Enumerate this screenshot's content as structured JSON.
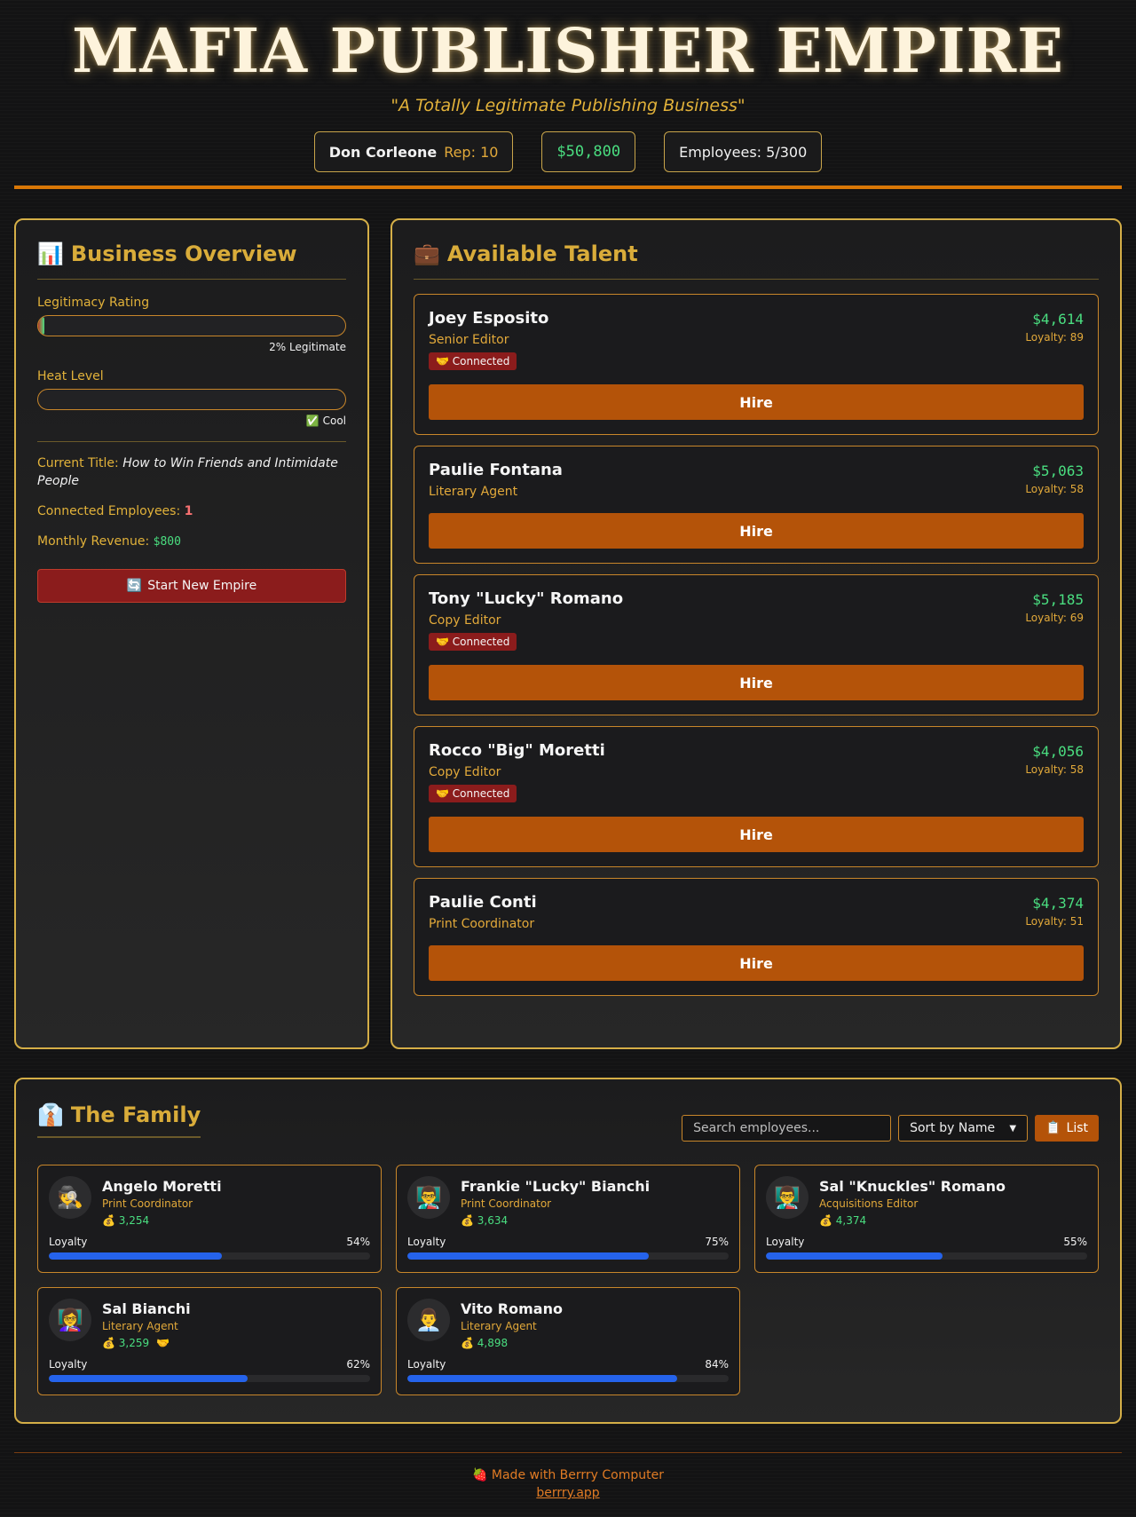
{
  "header": {
    "title": "MAFIA PUBLISHER EMPIRE",
    "subtitle": "\"A Totally Legitimate Publishing Business\"",
    "boss_name": "Don Corleone",
    "rep": "Rep: 10",
    "cash": "$50,800",
    "employees": "Employees: 5/300"
  },
  "overview": {
    "heading_icon": "📊",
    "heading": "Business Overview",
    "legitimacy_label": "Legitimacy Rating",
    "legitimacy_value": 2,
    "legitimacy_caption": "2% Legitimate",
    "heat_label": "Heat Level",
    "heat_value": 0,
    "heat_caption": "✅ Cool",
    "current_title_label": "Current Title:",
    "current_title": "How to Win Friends and Intimidate People",
    "connected_label": "Connected Employees:",
    "connected_value": "1",
    "revenue_label": "Monthly Revenue:",
    "revenue_value": "$800",
    "new_empire_icon": "🔄",
    "new_empire_label": "Start New Empire"
  },
  "talent": {
    "heading_icon": "💼",
    "heading": "Available Talent",
    "hire_label": "Hire",
    "candidates": [
      {
        "name": "Joey Esposito",
        "role": "Senior Editor",
        "price": "$4,614",
        "loyalty": "Loyalty: 89",
        "badge": "🤝 Connected"
      },
      {
        "name": "Paulie Fontana",
        "role": "Literary Agent",
        "price": "$5,063",
        "loyalty": "Loyalty: 58",
        "badge": ""
      },
      {
        "name": "Tony \"Lucky\" Romano",
        "role": "Copy Editor",
        "price": "$5,185",
        "loyalty": "Loyalty: 69",
        "badge": "🤝 Connected"
      },
      {
        "name": "Rocco \"Big\" Moretti",
        "role": "Copy Editor",
        "price": "$4,056",
        "loyalty": "Loyalty: 58",
        "badge": "🤝 Connected"
      },
      {
        "name": "Paulie Conti",
        "role": "Print Coordinator",
        "price": "$4,374",
        "loyalty": "Loyalty: 51",
        "badge": ""
      }
    ]
  },
  "family": {
    "heading_icon": "👔",
    "heading": "The Family",
    "search_placeholder": "Search employees...",
    "sort_label": "Sort by Name",
    "list_icon": "📋",
    "list_label": "List",
    "loyalty_label": "Loyalty",
    "members": [
      {
        "avatar": "🕵️",
        "name": "Angelo Moretti",
        "role": "Print Coordinator",
        "money": "💰 3,254",
        "connected": "",
        "loyalty": 54,
        "loyalty_text": "54%"
      },
      {
        "avatar": "👨‍🏫",
        "name": "Frankie \"Lucky\" Bianchi",
        "role": "Print Coordinator",
        "money": "💰 3,634",
        "connected": "",
        "loyalty": 75,
        "loyalty_text": "75%"
      },
      {
        "avatar": "👨‍🏫",
        "name": "Sal \"Knuckles\" Romano",
        "role": "Acquisitions Editor",
        "money": "💰 4,374",
        "connected": "",
        "loyalty": 55,
        "loyalty_text": "55%"
      },
      {
        "avatar": "👩‍🏫",
        "name": "Sal Bianchi",
        "role": "Literary Agent",
        "money": "💰 3,259",
        "connected": "🤝",
        "loyalty": 62,
        "loyalty_text": "62%"
      },
      {
        "avatar": "👨‍💼",
        "name": "Vito Romano",
        "role": "Literary Agent",
        "money": "💰 4,898",
        "connected": "",
        "loyalty": 84,
        "loyalty_text": "84%"
      }
    ]
  },
  "footer": {
    "made_with": "🍓 Made with Berrry Computer",
    "link": "berrry.app"
  },
  "colors": {
    "gold": "#d9ac3a",
    "orange": "#b45309",
    "green": "#4ade80",
    "red": "#8b1c1c",
    "blue": "#2563eb"
  }
}
